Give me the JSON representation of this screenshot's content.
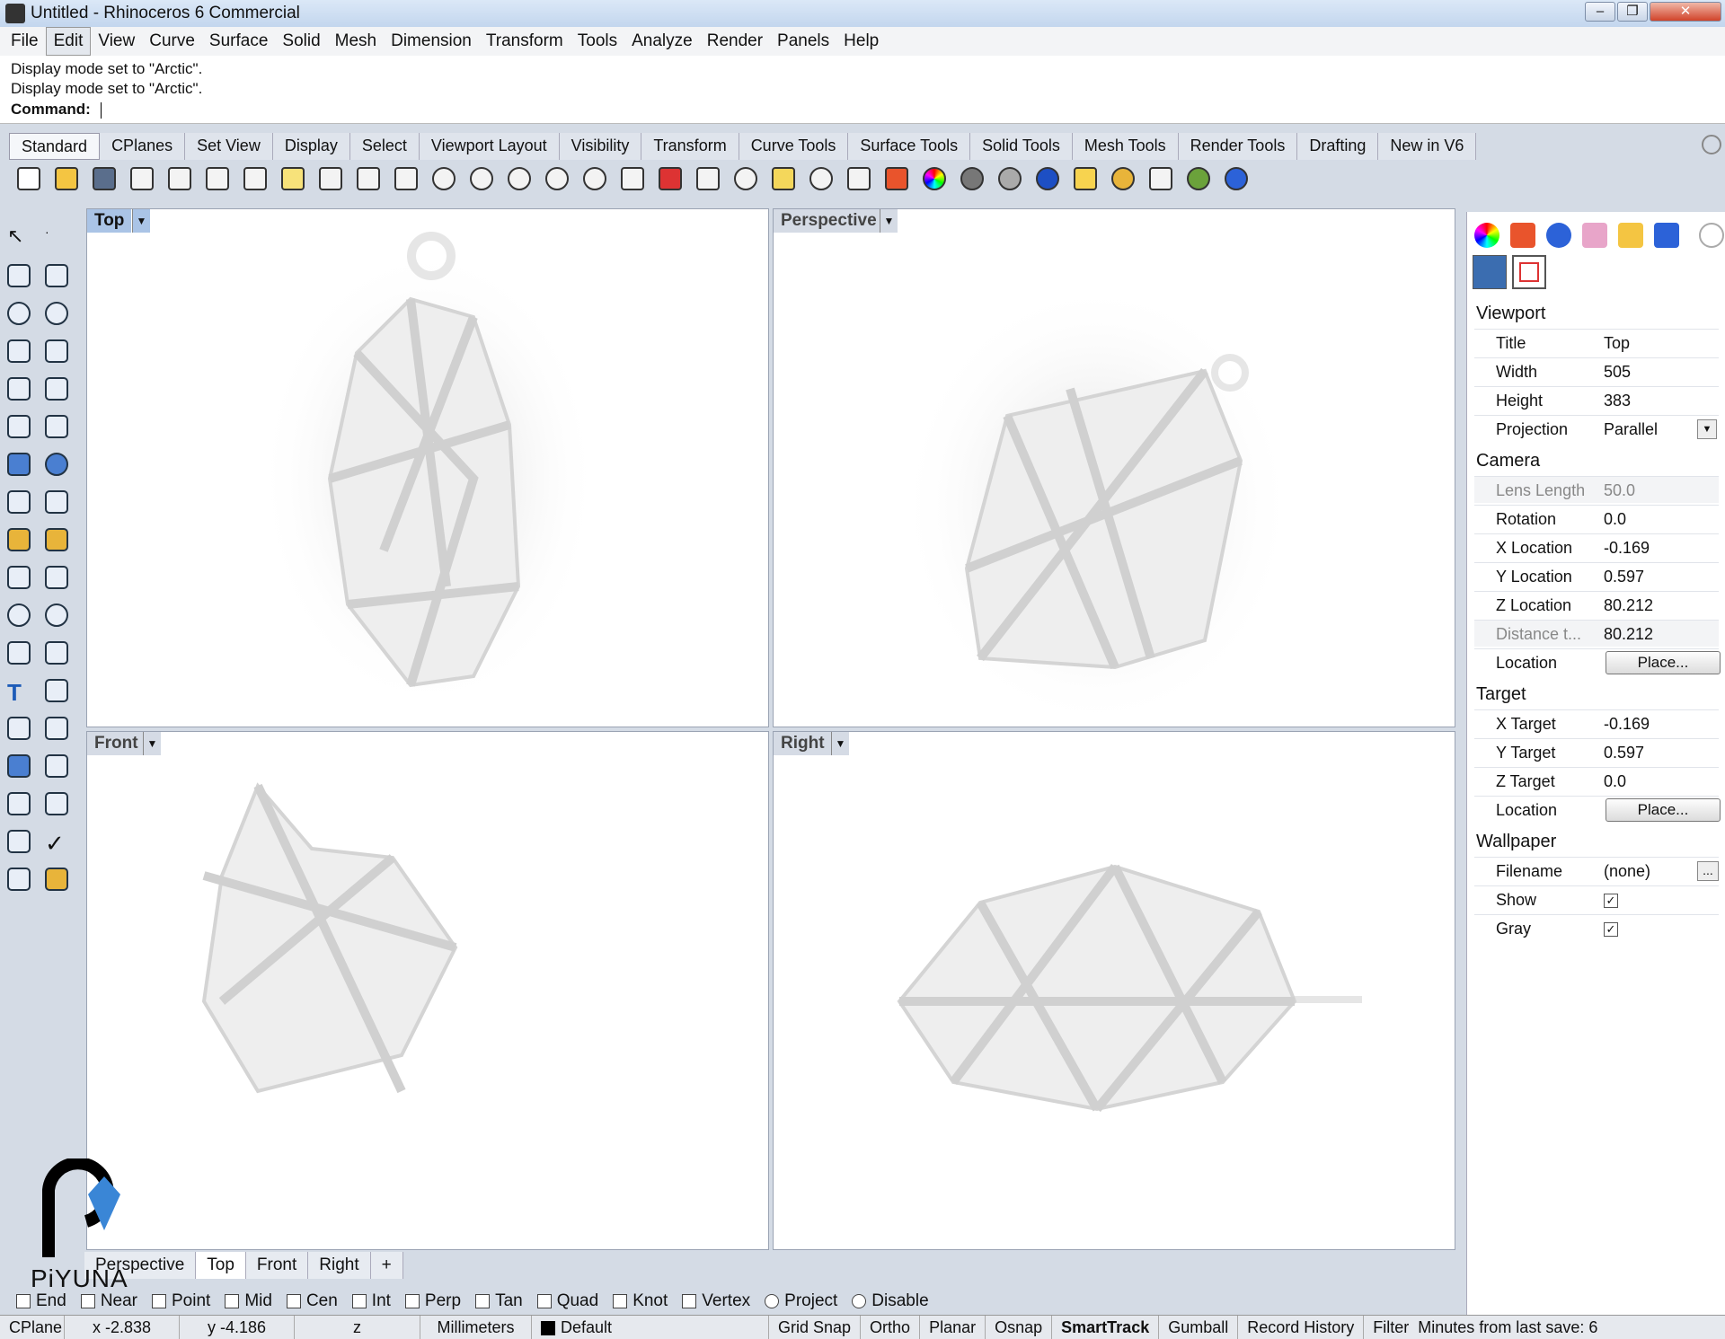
{
  "window": {
    "title": "Untitled - Rhinoceros 6 Commercial"
  },
  "menu": [
    "File",
    "Edit",
    "View",
    "Curve",
    "Surface",
    "Solid",
    "Mesh",
    "Dimension",
    "Transform",
    "Tools",
    "Analyze",
    "Render",
    "Panels",
    "Help"
  ],
  "history": [
    "Display mode set to \"Arctic\".",
    "Display mode set to \"Arctic\"."
  ],
  "command": {
    "label": "Command:"
  },
  "tabs": [
    "Standard",
    "CPlanes",
    "Set View",
    "Display",
    "Select",
    "Viewport Layout",
    "Visibility",
    "Transform",
    "Curve Tools",
    "Surface Tools",
    "Solid Tools",
    "Mesh Tools",
    "Render Tools",
    "Drafting",
    "New in V6"
  ],
  "viewports": {
    "top": "Top",
    "perspective": "Perspective",
    "front": "Front",
    "right": "Right"
  },
  "panel": {
    "viewport_section": "Viewport",
    "title_k": "Title",
    "title_v": "Top",
    "width_k": "Width",
    "width_v": "505",
    "height_k": "Height",
    "height_v": "383",
    "projection_k": "Projection",
    "projection_v": "Parallel",
    "camera_section": "Camera",
    "lens_k": "Lens Length",
    "lens_v": "50.0",
    "rotation_k": "Rotation",
    "rotation_v": "0.0",
    "xloc_k": "X Location",
    "xloc_v": "-0.169",
    "yloc_k": "Y Location",
    "yloc_v": "0.597",
    "zloc_k": "Z Location",
    "zloc_v": "80.212",
    "dist_k": "Distance t...",
    "dist_v": "80.212",
    "loc_k": "Location",
    "place": "Place...",
    "target_section": "Target",
    "xt_k": "X Target",
    "xt_v": "-0.169",
    "yt_k": "Y Target",
    "yt_v": "0.597",
    "zt_k": "Z Target",
    "zt_v": "0.0",
    "wall_section": "Wallpaper",
    "file_k": "Filename",
    "file_v": "(none)",
    "ellipsis": "...",
    "show_k": "Show",
    "gray_k": "Gray",
    "check": "✓"
  },
  "vptabs": [
    "Perspective",
    "Top",
    "Front",
    "Right",
    "+"
  ],
  "osnaps": [
    "End",
    "Near",
    "Point",
    "Mid",
    "Cen",
    "Int",
    "Perp",
    "Tan",
    "Quad",
    "Knot",
    "Vertex",
    "Project",
    "Disable"
  ],
  "status": {
    "cplane": "CPlane",
    "x": "x -2.838",
    "y": "y -4.186",
    "z": "z",
    "units": "Millimeters",
    "layer": "Default",
    "gridsnap": "Grid Snap",
    "ortho": "Ortho",
    "planar": "Planar",
    "osnap": "Osnap",
    "smarttrack": "SmartTrack",
    "gumball": "Gumball",
    "record": "Record History",
    "filter": "Filter",
    "save": "Minutes from last save: 6"
  },
  "logo": {
    "text": "PiYUNA"
  }
}
